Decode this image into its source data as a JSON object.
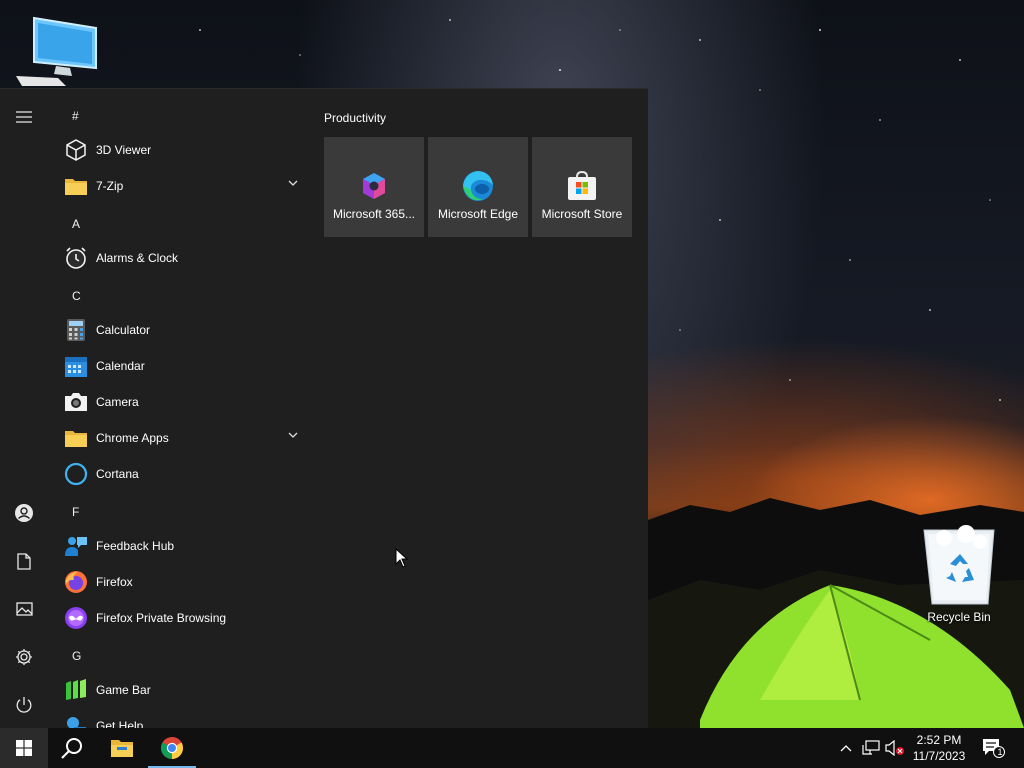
{
  "desktop": {
    "icons": [
      {
        "label": "",
        "icon": "this-pc-icon"
      },
      {
        "label": "Recycle Bin",
        "icon": "recycle-bin-icon"
      }
    ]
  },
  "start_menu": {
    "rail": [
      {
        "name": "expand",
        "icon": "hamburger-icon"
      },
      {
        "name": "account",
        "icon": "user-icon"
      },
      {
        "name": "documents",
        "icon": "document-icon"
      },
      {
        "name": "pictures",
        "icon": "pictures-icon"
      },
      {
        "name": "settings",
        "icon": "gear-icon"
      },
      {
        "name": "power",
        "icon": "power-icon"
      }
    ],
    "groups": {
      "hash": "#",
      "a": "A",
      "c": "C",
      "f": "F",
      "g": "G"
    },
    "apps": [
      {
        "label": "3D Viewer",
        "icon": "3d-viewer-icon"
      },
      {
        "label": "7-Zip",
        "icon": "folder-icon",
        "expandable": true
      },
      {
        "label": "Alarms & Clock",
        "icon": "alarm-clock-icon"
      },
      {
        "label": "Calculator",
        "icon": "calculator-icon"
      },
      {
        "label": "Calendar",
        "icon": "calendar-icon"
      },
      {
        "label": "Camera",
        "icon": "camera-icon"
      },
      {
        "label": "Chrome Apps",
        "icon": "folder-icon",
        "expandable": true
      },
      {
        "label": "Cortana",
        "icon": "cortana-icon"
      },
      {
        "label": "Feedback Hub",
        "icon": "feedback-hub-icon"
      },
      {
        "label": "Firefox",
        "icon": "firefox-icon"
      },
      {
        "label": "Firefox Private Browsing",
        "icon": "firefox-private-icon"
      },
      {
        "label": "Game Bar",
        "icon": "game-bar-icon"
      },
      {
        "label": "Get Help",
        "icon": "get-help-icon"
      }
    ],
    "tile_group": {
      "title": "Productivity",
      "tiles": [
        {
          "label": "Microsoft 365...",
          "icon": "microsoft-365-icon"
        },
        {
          "label": "Microsoft Edge",
          "icon": "edge-icon"
        },
        {
          "label": "Microsoft Store",
          "icon": "store-icon"
        }
      ]
    }
  },
  "taskbar": {
    "buttons": [
      {
        "name": "start",
        "icon": "windows-logo-icon",
        "active": true
      },
      {
        "name": "search",
        "icon": "search-icon"
      },
      {
        "name": "file-explorer",
        "icon": "file-explorer-icon"
      },
      {
        "name": "chrome",
        "icon": "chrome-icon",
        "running": true
      }
    ],
    "tray": {
      "time": "2:52 PM",
      "date": "11/7/2023",
      "notification_count": "1"
    }
  },
  "colors": {
    "start_bg": "#1f1f1f",
    "tile_bg": "#3a3a3a",
    "taskbar_bg": "#101010",
    "accent": "#76b9ed"
  }
}
